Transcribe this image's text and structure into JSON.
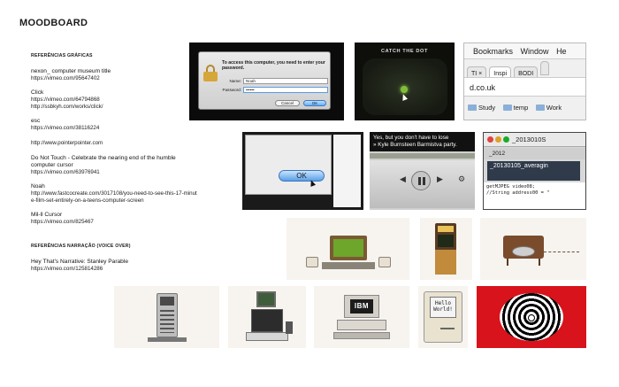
{
  "page": {
    "title": "MOODBOARD"
  },
  "references": {
    "section_title": "REFERÊNCIAS GRÁFICAS",
    "items": [
      {
        "title": "nexon_ computer museum title",
        "urls": [
          "https://vimeo.com/95647402"
        ]
      },
      {
        "title": "Click",
        "urls": [
          "https://vimeo.com/64794868",
          "http://ssbkyh.com/works/click/"
        ]
      },
      {
        "title": "esc",
        "urls": [
          "https://vimeo.com/38116224"
        ]
      },
      {
        "title": "",
        "urls": [
          "http://www.pointerpointer.com"
        ]
      },
      {
        "title": "Do Not Touch - Celebrate the nearing end of the humble computer cursor",
        "urls": [
          "https://vimeo.com/63976941"
        ]
      },
      {
        "title": "Noah",
        "urls": [
          "http://www.fastcocreate.com/3017108/you-need-to-see-this-17-minute-film-set-entirely-on-a-teens-computer-screen"
        ]
      },
      {
        "title": "Mil-ll Cursor",
        "urls": [
          "https://vimeo.com/825467"
        ]
      }
    ]
  },
  "narration": {
    "section_title": "REFERÊNCIAS NARRAÇÃO (VOICE OVER)",
    "items": [
      {
        "title": "Hey That's Narrative: Stanley Parable",
        "urls": [
          "https://vimeo.com/125814286"
        ]
      }
    ]
  },
  "thumbnails": {
    "login": {
      "message": "To access this computer, you need to enter your password.",
      "name_label": "Name:",
      "name_value": "Noah",
      "password_label": "Password:",
      "password_value": "••••••",
      "cancel_label": "Cancel",
      "ok_label": "OK"
    },
    "dot": {
      "title": "CATCH THE DOT"
    },
    "browser": {
      "menu": [
        "Bookmarks",
        "Window",
        "He"
      ],
      "tabs": [
        "TI ×",
        "Inspi",
        "BODI",
        ""
      ],
      "url": "d.co.uk",
      "bookmarks": [
        "Study",
        "temp",
        "Work"
      ]
    },
    "ok_dialog": {
      "ok_label": "OK"
    },
    "player": {
      "caption_line1": "Yes, but you don't have to lose",
      "caption_line2": "» Kyle Burnsteen Barmistva party."
    },
    "devtools": {
      "window_title": "_2013010S",
      "toolbar_text": "_2012",
      "tab_text": "_20130105_averagin",
      "code_line1": "getMJPEG video08;",
      "code_line2": "//String address00 = \""
    },
    "ibm": {
      "label": "IBM"
    },
    "mac": {
      "screen_text": "Hello World!"
    }
  }
}
